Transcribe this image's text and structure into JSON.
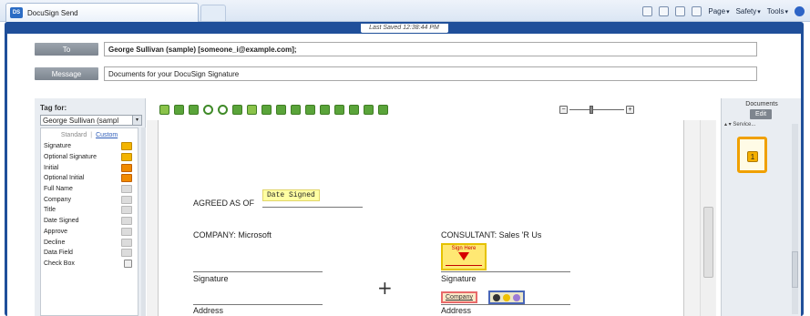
{
  "browser": {
    "tab_title": "DocuSign Send",
    "commands": [
      "Page",
      "Safety",
      "Tools"
    ]
  },
  "status": {
    "last_saved": "Last Saved 12:38:44 PM"
  },
  "address": {
    "to_label": "To",
    "to_value": "George Sullivan (sample) [someone_i@example.com];",
    "message_label": "Message",
    "message_value": "Documents for your DocuSign Signature"
  },
  "tag_panel": {
    "title": "Tag for:",
    "recipient": "George Sullivan (sampl",
    "tab_standard": "Standard",
    "tab_custom": "Custom",
    "items": [
      {
        "label": "Signature",
        "icon": "signature-tag-icon"
      },
      {
        "label": "Optional Signature",
        "icon": "optional-signature-tag-icon"
      },
      {
        "label": "Initial",
        "icon": "initial-tag-icon"
      },
      {
        "label": "Optional Initial",
        "icon": "optional-initial-tag-icon"
      },
      {
        "label": "Full Name",
        "icon": "full-name-tag-icon"
      },
      {
        "label": "Company",
        "icon": "company-tag-icon"
      },
      {
        "label": "Title",
        "icon": "title-tag-icon"
      },
      {
        "label": "Date Signed",
        "icon": "date-signed-tag-icon"
      },
      {
        "label": "Approve",
        "icon": "approve-tag-icon"
      },
      {
        "label": "Decline",
        "icon": "decline-tag-icon"
      },
      {
        "label": "Data Field",
        "icon": "data-field-tag-icon"
      },
      {
        "label": "Check Box",
        "icon": "check-box-tag-icon"
      }
    ]
  },
  "document": {
    "agreed_as_of": "AGREED AS OF",
    "date_signed_field": "Date Signed",
    "company_heading": "COMPANY: Microsoft",
    "consultant_heading": "CONSULTANT: Sales 'R Us",
    "signature_left": "Signature",
    "signature_right": "Signature",
    "address_left": "Address",
    "address_right": "Address",
    "sign_here": "Sign Here",
    "company_field": "Company"
  },
  "docs_panel": {
    "title": "Documents",
    "edit_label": "Edit",
    "tree_label": "▴ ▾ Service...",
    "page_number": "1"
  }
}
